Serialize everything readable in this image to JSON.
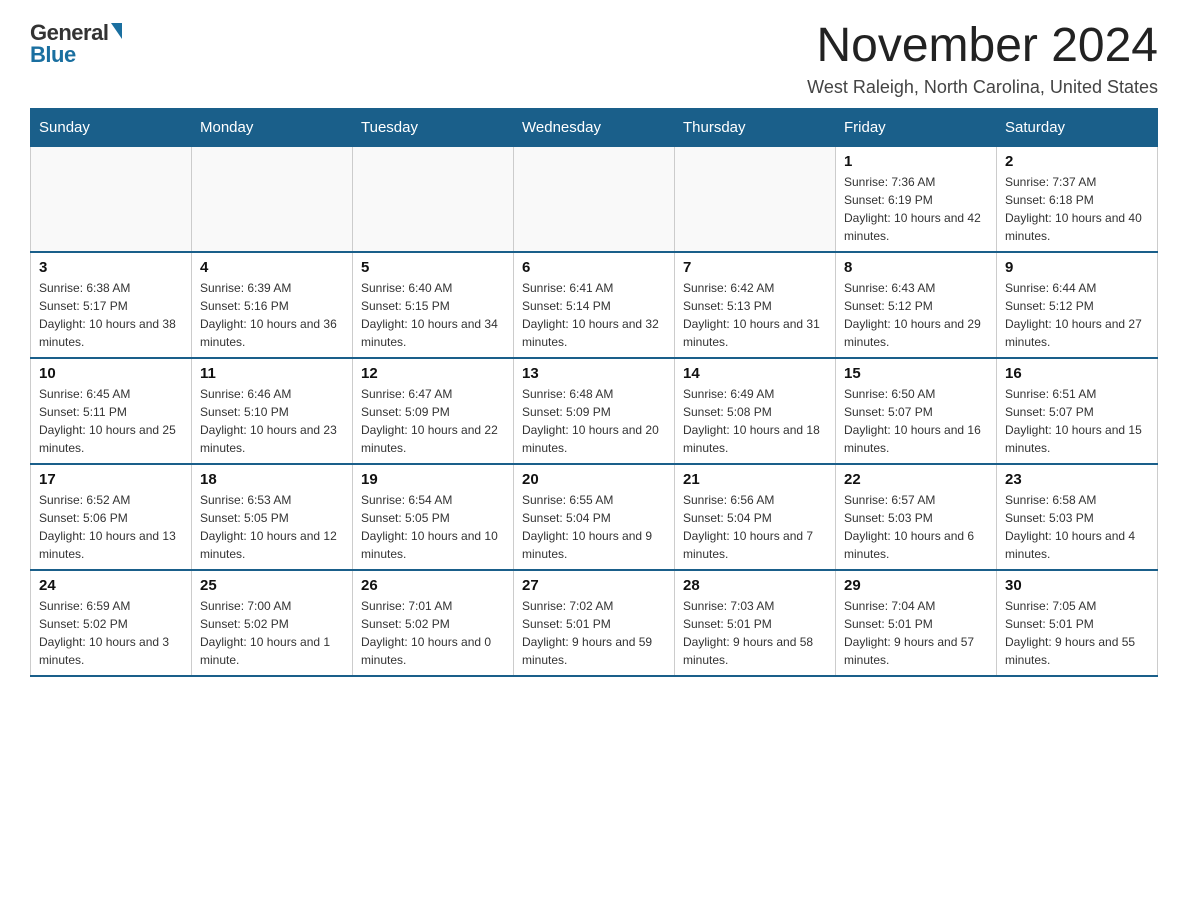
{
  "logo": {
    "general": "General",
    "blue": "Blue",
    "arrow": "▶"
  },
  "title": "November 2024",
  "location": "West Raleigh, North Carolina, United States",
  "days_of_week": [
    "Sunday",
    "Monday",
    "Tuesday",
    "Wednesday",
    "Thursday",
    "Friday",
    "Saturday"
  ],
  "weeks": [
    [
      {
        "day": "",
        "info": ""
      },
      {
        "day": "",
        "info": ""
      },
      {
        "day": "",
        "info": ""
      },
      {
        "day": "",
        "info": ""
      },
      {
        "day": "",
        "info": ""
      },
      {
        "day": "1",
        "info": "Sunrise: 7:36 AM\nSunset: 6:19 PM\nDaylight: 10 hours and 42 minutes."
      },
      {
        "day": "2",
        "info": "Sunrise: 7:37 AM\nSunset: 6:18 PM\nDaylight: 10 hours and 40 minutes."
      }
    ],
    [
      {
        "day": "3",
        "info": "Sunrise: 6:38 AM\nSunset: 5:17 PM\nDaylight: 10 hours and 38 minutes."
      },
      {
        "day": "4",
        "info": "Sunrise: 6:39 AM\nSunset: 5:16 PM\nDaylight: 10 hours and 36 minutes."
      },
      {
        "day": "5",
        "info": "Sunrise: 6:40 AM\nSunset: 5:15 PM\nDaylight: 10 hours and 34 minutes."
      },
      {
        "day": "6",
        "info": "Sunrise: 6:41 AM\nSunset: 5:14 PM\nDaylight: 10 hours and 32 minutes."
      },
      {
        "day": "7",
        "info": "Sunrise: 6:42 AM\nSunset: 5:13 PM\nDaylight: 10 hours and 31 minutes."
      },
      {
        "day": "8",
        "info": "Sunrise: 6:43 AM\nSunset: 5:12 PM\nDaylight: 10 hours and 29 minutes."
      },
      {
        "day": "9",
        "info": "Sunrise: 6:44 AM\nSunset: 5:12 PM\nDaylight: 10 hours and 27 minutes."
      }
    ],
    [
      {
        "day": "10",
        "info": "Sunrise: 6:45 AM\nSunset: 5:11 PM\nDaylight: 10 hours and 25 minutes."
      },
      {
        "day": "11",
        "info": "Sunrise: 6:46 AM\nSunset: 5:10 PM\nDaylight: 10 hours and 23 minutes."
      },
      {
        "day": "12",
        "info": "Sunrise: 6:47 AM\nSunset: 5:09 PM\nDaylight: 10 hours and 22 minutes."
      },
      {
        "day": "13",
        "info": "Sunrise: 6:48 AM\nSunset: 5:09 PM\nDaylight: 10 hours and 20 minutes."
      },
      {
        "day": "14",
        "info": "Sunrise: 6:49 AM\nSunset: 5:08 PM\nDaylight: 10 hours and 18 minutes."
      },
      {
        "day": "15",
        "info": "Sunrise: 6:50 AM\nSunset: 5:07 PM\nDaylight: 10 hours and 16 minutes."
      },
      {
        "day": "16",
        "info": "Sunrise: 6:51 AM\nSunset: 5:07 PM\nDaylight: 10 hours and 15 minutes."
      }
    ],
    [
      {
        "day": "17",
        "info": "Sunrise: 6:52 AM\nSunset: 5:06 PM\nDaylight: 10 hours and 13 minutes."
      },
      {
        "day": "18",
        "info": "Sunrise: 6:53 AM\nSunset: 5:05 PM\nDaylight: 10 hours and 12 minutes."
      },
      {
        "day": "19",
        "info": "Sunrise: 6:54 AM\nSunset: 5:05 PM\nDaylight: 10 hours and 10 minutes."
      },
      {
        "day": "20",
        "info": "Sunrise: 6:55 AM\nSunset: 5:04 PM\nDaylight: 10 hours and 9 minutes."
      },
      {
        "day": "21",
        "info": "Sunrise: 6:56 AM\nSunset: 5:04 PM\nDaylight: 10 hours and 7 minutes."
      },
      {
        "day": "22",
        "info": "Sunrise: 6:57 AM\nSunset: 5:03 PM\nDaylight: 10 hours and 6 minutes."
      },
      {
        "day": "23",
        "info": "Sunrise: 6:58 AM\nSunset: 5:03 PM\nDaylight: 10 hours and 4 minutes."
      }
    ],
    [
      {
        "day": "24",
        "info": "Sunrise: 6:59 AM\nSunset: 5:02 PM\nDaylight: 10 hours and 3 minutes."
      },
      {
        "day": "25",
        "info": "Sunrise: 7:00 AM\nSunset: 5:02 PM\nDaylight: 10 hours and 1 minute."
      },
      {
        "day": "26",
        "info": "Sunrise: 7:01 AM\nSunset: 5:02 PM\nDaylight: 10 hours and 0 minutes."
      },
      {
        "day": "27",
        "info": "Sunrise: 7:02 AM\nSunset: 5:01 PM\nDaylight: 9 hours and 59 minutes."
      },
      {
        "day": "28",
        "info": "Sunrise: 7:03 AM\nSunset: 5:01 PM\nDaylight: 9 hours and 58 minutes."
      },
      {
        "day": "29",
        "info": "Sunrise: 7:04 AM\nSunset: 5:01 PM\nDaylight: 9 hours and 57 minutes."
      },
      {
        "day": "30",
        "info": "Sunrise: 7:05 AM\nSunset: 5:01 PM\nDaylight: 9 hours and 55 minutes."
      }
    ]
  ]
}
